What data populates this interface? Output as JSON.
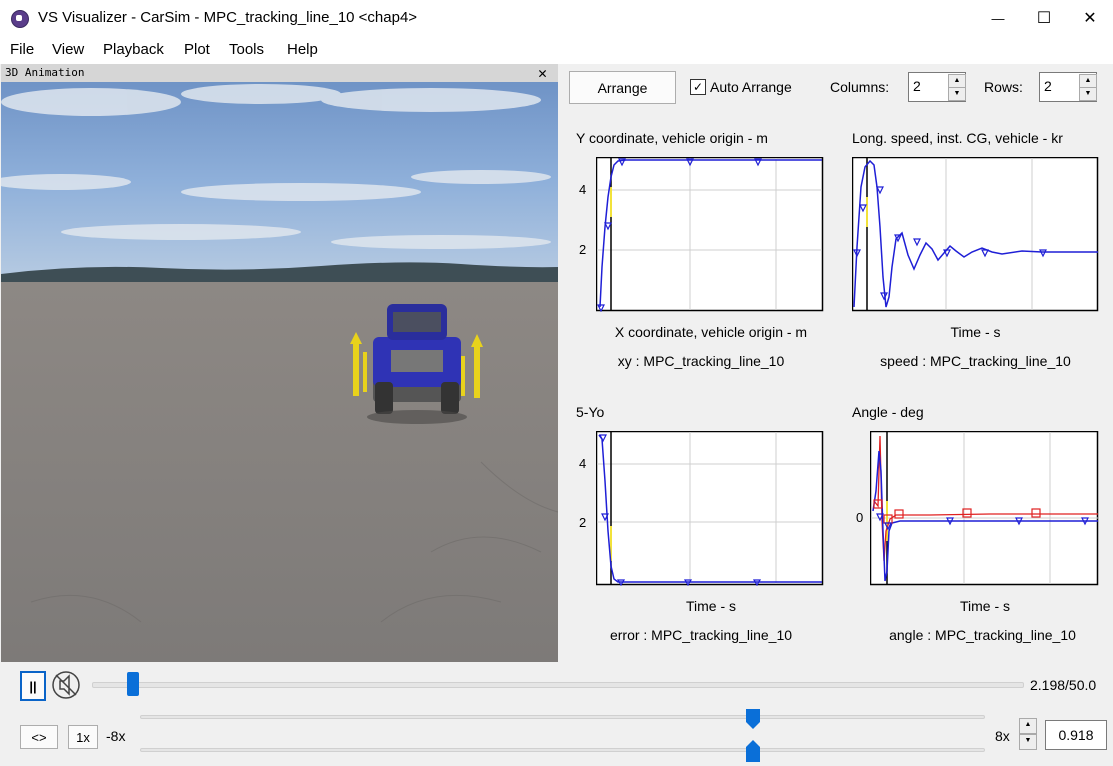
{
  "window": {
    "title": "VS Visualizer - CarSim - MPC_tracking_line_10 <chap4>",
    "minimize_glyph": "—",
    "maximize_glyph": "☐",
    "close_glyph": "✕"
  },
  "menu": [
    "File",
    "View",
    "Playback",
    "Plot",
    "Tools",
    "Help"
  ],
  "animation": {
    "title": "3D Animation",
    "close_glyph": "✕"
  },
  "toolbar": {
    "arrange_label": "Arrange",
    "auto_arrange_label": "Auto Arrange",
    "auto_arrange_checked": true,
    "check_glyph": "✓",
    "columns_label": "Columns:",
    "columns_value": "2",
    "rows_label": "Rows:",
    "rows_value": "2"
  },
  "plots": [
    {
      "title": "Y coordinate, vehicle origin - m",
      "xlabel": "X coordinate, vehicle origin - m",
      "legend": "xy : MPC_tracking_line_10",
      "yticks": [
        "4",
        "2"
      ]
    },
    {
      "title": "Long. speed, inst. CG, vehicle - kr",
      "xlabel": "Time - s",
      "legend": "speed : MPC_tracking_line_10",
      "yticks": []
    },
    {
      "title": "5-Yo",
      "xlabel": "Time - s",
      "legend": "error : MPC_tracking_line_10",
      "yticks": [
        "4",
        "2"
      ]
    },
    {
      "title": "Angle - deg",
      "xlabel": "Time - s",
      "legend": "angle : MPC_tracking_line_10",
      "yticks": [
        "0"
      ]
    }
  ],
  "playback": {
    "pause_glyph": "||",
    "time_readout": "2.198/50.0",
    "time_current": 2.198,
    "time_total": 50.0,
    "reverse_label": "<>",
    "speed_1x_label": "1x",
    "speed_min_label": "-8x",
    "speed_max_label": "8x",
    "speed_value": "0.918"
  },
  "colors": {
    "series_blue": "#1f1fd6",
    "series_red": "#e02020",
    "marker_yellow": "#f2e23a"
  }
}
